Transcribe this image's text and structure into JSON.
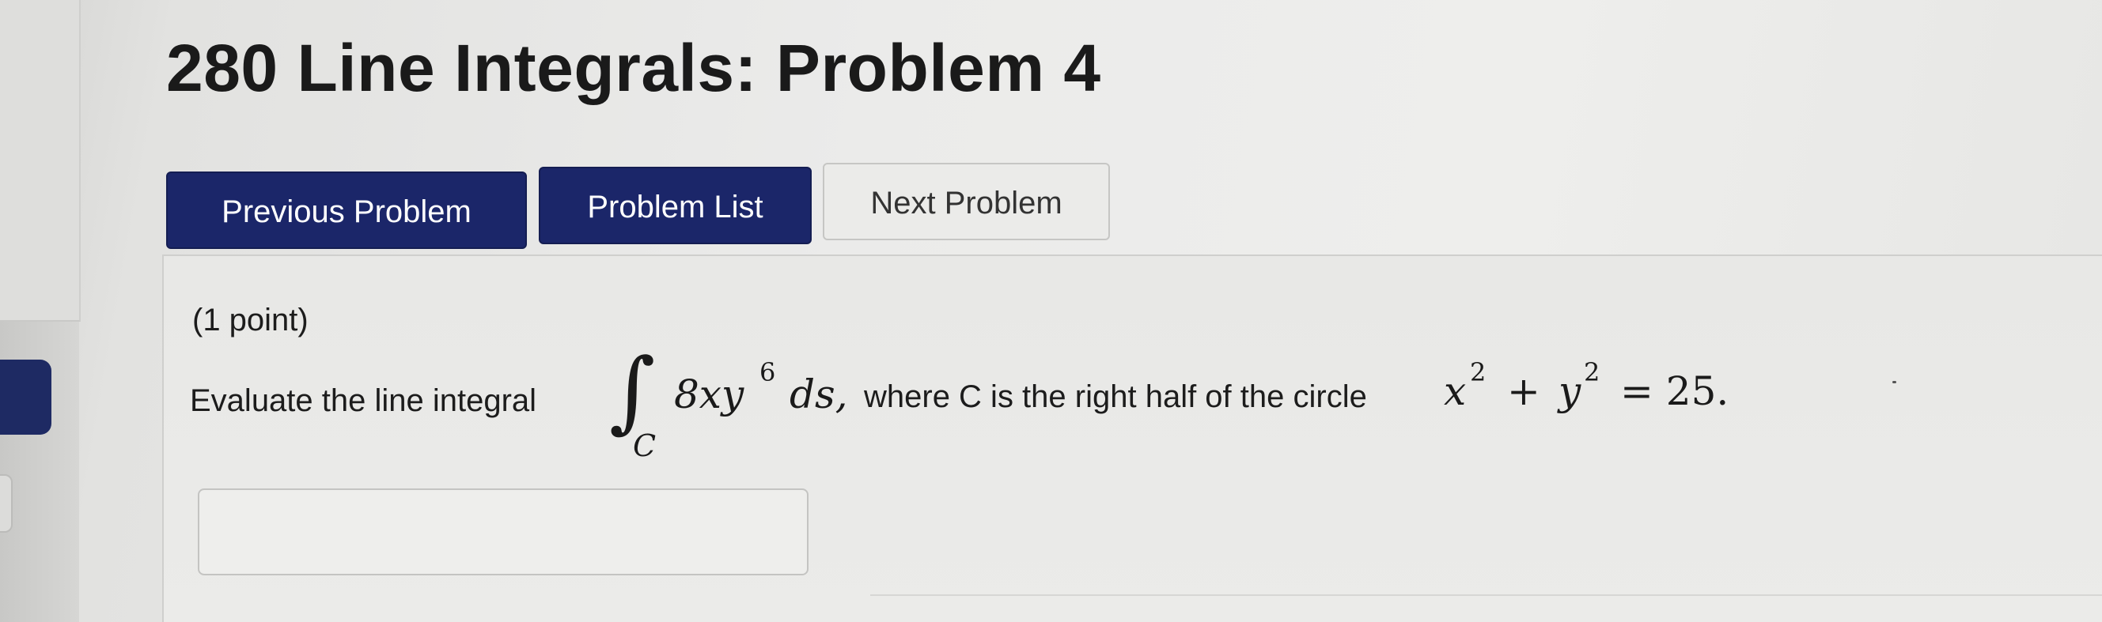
{
  "page": {
    "title": "280 Line Integrals: Problem 4"
  },
  "nav": {
    "previous_label": "Previous Problem",
    "list_label": "Problem List",
    "next_label": "Next Problem"
  },
  "problem": {
    "points": "(1 point)",
    "prompt_before": "Evaluate the line integral",
    "integral_symbol": "∫",
    "integral_subscript": "C",
    "integrand_coef": "8xy",
    "integrand_exp": "6",
    "integrand_ds": "ds,",
    "prompt_after": "where C is the right half of the circle",
    "eq_x": "x",
    "eq_x_exp": "2",
    "eq_plus": "+",
    "eq_y": "y",
    "eq_y_exp": "2",
    "eq_rhs": "= 25."
  },
  "answer": {
    "value": ""
  },
  "colors": {
    "primary_button": "#1b2669",
    "secondary_button": "#ebebe9"
  },
  "icons": {
    "integral": "integral-sign"
  }
}
